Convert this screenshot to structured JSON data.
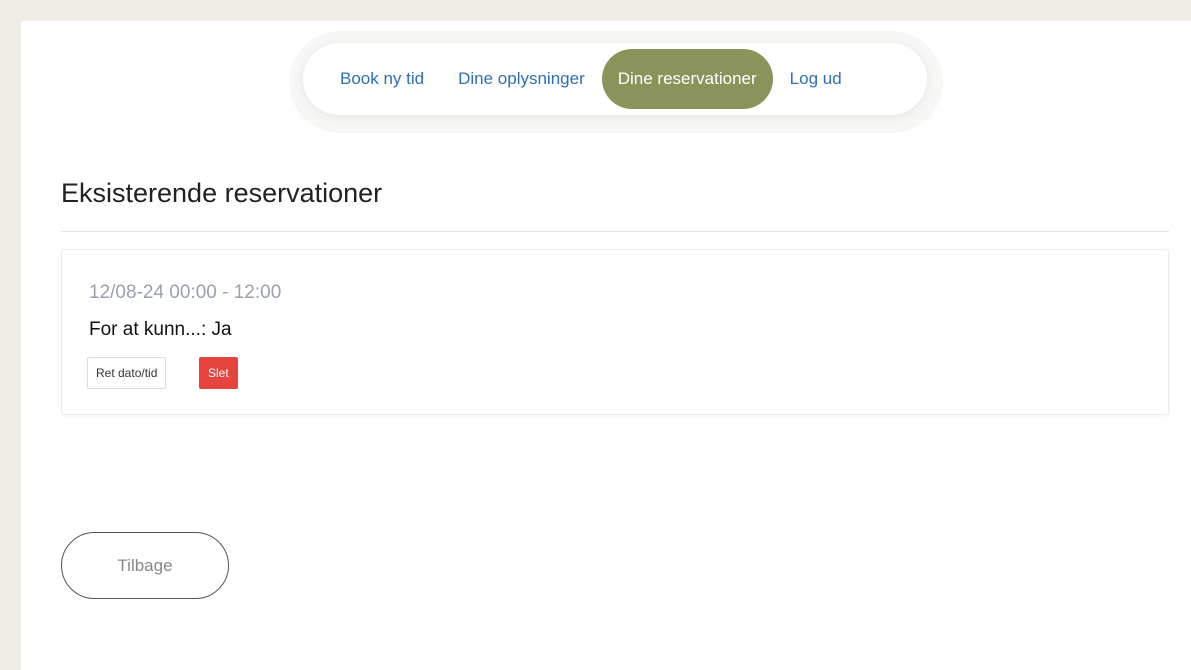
{
  "nav": {
    "items": [
      {
        "label": "Book ny tid",
        "active": false
      },
      {
        "label": "Dine oplysninger",
        "active": false
      },
      {
        "label": "Dine reservationer",
        "active": true
      },
      {
        "label": "Log ud",
        "active": false
      }
    ]
  },
  "page": {
    "title": "Eksisterende reservationer"
  },
  "reservations": [
    {
      "datetime": "12/08-24 00:00 - 12:00",
      "detail": "For at kunn...: Ja",
      "edit_label": "Ret dato/tid",
      "delete_label": "Slet"
    }
  ],
  "footer": {
    "back_label": "Tilbage"
  },
  "colors": {
    "background": "#eeece4",
    "nav_active": "#8a9359",
    "nav_link": "#2f6fb4",
    "delete": "#e5443f"
  }
}
